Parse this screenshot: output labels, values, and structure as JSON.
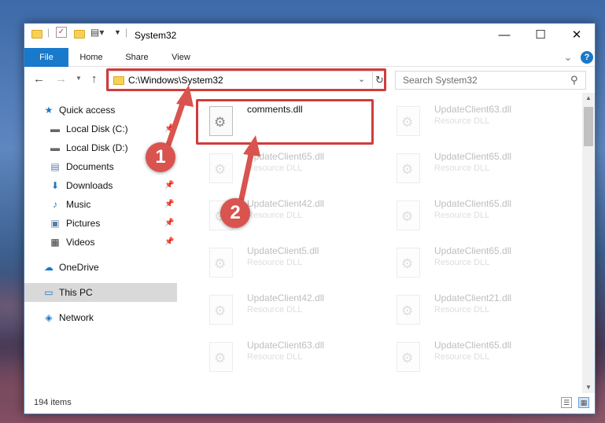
{
  "window": {
    "title": "System32",
    "controls": {
      "minimize": "—",
      "maximize": "☐",
      "close": "✕"
    }
  },
  "ribbon": {
    "tabs": [
      "File",
      "Home",
      "Share",
      "View"
    ],
    "collapse_glyph": "⌄",
    "help_glyph": "?"
  },
  "address": {
    "path": "C:\\Windows\\System32",
    "search_placeholder": "Search System32"
  },
  "nav": {
    "items": [
      {
        "label": "Quick access",
        "icon": "★"
      },
      {
        "label": "Local Disk (C:)",
        "icon": "▬"
      },
      {
        "label": "Local Disk (D:)",
        "icon": "▬"
      },
      {
        "label": "Documents",
        "icon": "▤"
      },
      {
        "label": "Downloads",
        "icon": "⬇"
      },
      {
        "label": "Music",
        "icon": "♪"
      },
      {
        "label": "Pictures",
        "icon": "▣"
      },
      {
        "label": "Videos",
        "icon": "▦"
      },
      {
        "label": "OneDrive",
        "icon": "☁"
      },
      {
        "label": "This PC",
        "icon": "▭"
      },
      {
        "label": "Network",
        "icon": "◈"
      }
    ],
    "pin_glyph": "📌"
  },
  "files": {
    "left": [
      {
        "name": "comments.dll",
        "type": ""
      },
      {
        "name": "UpdateClient65.dll",
        "type": "Resource DLL"
      },
      {
        "name": "UpdateClient42.dll",
        "type": "Resource DLL"
      },
      {
        "name": "UpdateClient5.dll",
        "type": "Resource DLL"
      },
      {
        "name": "UpdateClient42.dll",
        "type": "Resource DLL"
      },
      {
        "name": "UpdateClient63.dll",
        "type": "Resource DLL"
      }
    ],
    "right": [
      {
        "name": "UpdateClient63.dll",
        "type": "Resource DLL"
      },
      {
        "name": "UpdateClient65.dll",
        "type": "Resource DLL"
      },
      {
        "name": "UpdateClient65.dll",
        "type": "Resource DLL"
      },
      {
        "name": "UpdateClient65.dll",
        "type": "Resource DLL"
      },
      {
        "name": "UpdateClient21.dll",
        "type": "Resource DLL"
      },
      {
        "name": "UpdateClient65.dll",
        "type": "Resource DLL"
      }
    ]
  },
  "status": {
    "count": "194 items"
  },
  "callouts": {
    "step1": "1",
    "step2": "2"
  },
  "colors": {
    "accent": "#1979ca",
    "highlight": "#d13c3c",
    "badge": "#d9534f"
  }
}
